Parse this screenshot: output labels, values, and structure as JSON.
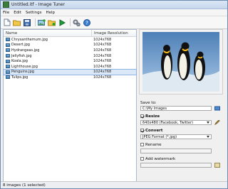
{
  "window": {
    "title": "Untitled.itf - Image Tuner"
  },
  "menu": [
    "File",
    "Edit",
    "Settings",
    "Help"
  ],
  "toolbar": [
    "new-file-icon",
    "open-folder-icon",
    "save-icon",
    "add-images-icon",
    "add-folder-icon",
    "run-icon",
    "settings-gears-icon",
    "help-icon"
  ],
  "list": {
    "columns": [
      "Name",
      "Image Resolution"
    ],
    "rows": [
      {
        "name": "Chrysanthemum.jpg",
        "res": "1024x768"
      },
      {
        "name": "Desert.jpg",
        "res": "1024x768"
      },
      {
        "name": "Hydrangeas.jpg",
        "res": "1024x768"
      },
      {
        "name": "Jellyfish.jpg",
        "res": "1024x768"
      },
      {
        "name": "Koala.jpg",
        "res": "1024x768"
      },
      {
        "name": "Lighthouse.jpg",
        "res": "1024x768"
      },
      {
        "name": "Penguins.jpg",
        "res": "1024x768"
      },
      {
        "name": "Tulips.jpg",
        "res": "1024x768"
      }
    ],
    "selected_index": 6
  },
  "panel": {
    "save_to_label": "Save to:",
    "save_to_value": "C:\\My Images",
    "resize_label": "Resize",
    "resize_value": "640x480 (Facebook, Twitter)",
    "convert_label": "Convert",
    "convert_value": "JPEG Format (*.jpg)",
    "rename_label": "Rename",
    "watermark_label": "Add watermark"
  },
  "status": "8 images (1 selected)"
}
